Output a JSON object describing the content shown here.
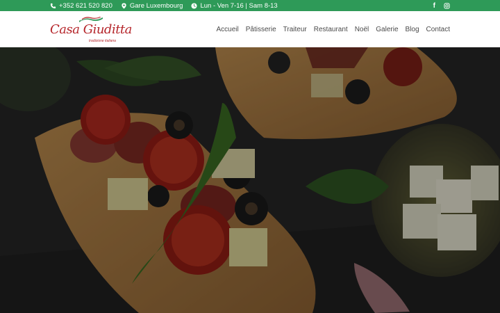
{
  "topbar": {
    "phone": "+352 621 520 820",
    "location": "Gare Luxembourg",
    "hours": "Lun - Ven 7-16 | Sam 8-13",
    "social": [
      {
        "icon": "facebook-icon",
        "label": "f"
      },
      {
        "icon": "instagram-icon"
      }
    ],
    "color": "#2e9a58"
  },
  "header": {
    "logo": {
      "brand": "Casa Giuditta",
      "tagline": "tradizione italiana"
    },
    "nav": [
      {
        "label": "Accueil"
      },
      {
        "label": "Pâtisserie"
      },
      {
        "label": "Traiteur"
      },
      {
        "label": "Restaurant"
      },
      {
        "label": "Noël"
      },
      {
        "label": "Galerie"
      },
      {
        "label": "Blog"
      },
      {
        "label": "Contact"
      }
    ]
  },
  "hero": {
    "image": "pizza-focaccia-photo"
  }
}
